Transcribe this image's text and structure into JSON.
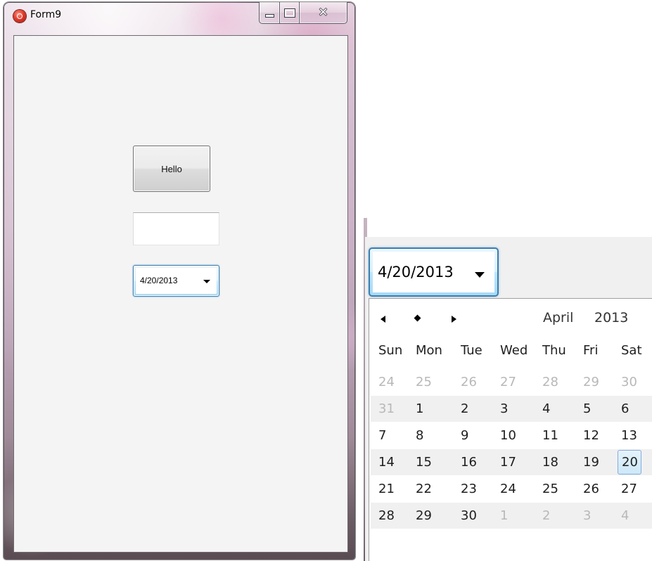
{
  "window": {
    "title": "Form9",
    "minimize_icon": "minimize-icon",
    "maximize_icon": "maximize-icon",
    "close_icon": "close-icon"
  },
  "form": {
    "button_label": "Hello",
    "textbox_value": "",
    "date_value": "4/20/2013"
  },
  "datepicker": {
    "value": "4/20/2013",
    "calendar": {
      "month": "April",
      "year": "2013",
      "weekdays": [
        "Sun",
        "Mon",
        "Tue",
        "Wed",
        "Thu",
        "Fri",
        "Sat"
      ],
      "weeks": [
        [
          {
            "d": "24",
            "dim": true
          },
          {
            "d": "25",
            "dim": true
          },
          {
            "d": "26",
            "dim": true
          },
          {
            "d": "27",
            "dim": true
          },
          {
            "d": "28",
            "dim": true
          },
          {
            "d": "29",
            "dim": true
          },
          {
            "d": "30",
            "dim": true
          }
        ],
        [
          {
            "d": "31",
            "dim": true
          },
          {
            "d": "1"
          },
          {
            "d": "2"
          },
          {
            "d": "3"
          },
          {
            "d": "4"
          },
          {
            "d": "5"
          },
          {
            "d": "6"
          }
        ],
        [
          {
            "d": "7"
          },
          {
            "d": "8"
          },
          {
            "d": "9"
          },
          {
            "d": "10"
          },
          {
            "d": "11"
          },
          {
            "d": "12"
          },
          {
            "d": "13"
          }
        ],
        [
          {
            "d": "14"
          },
          {
            "d": "15"
          },
          {
            "d": "16"
          },
          {
            "d": "17"
          },
          {
            "d": "18"
          },
          {
            "d": "19"
          },
          {
            "d": "20",
            "selected": true
          }
        ],
        [
          {
            "d": "21"
          },
          {
            "d": "22"
          },
          {
            "d": "23"
          },
          {
            "d": "24"
          },
          {
            "d": "25"
          },
          {
            "d": "26"
          },
          {
            "d": "27"
          }
        ],
        [
          {
            "d": "28"
          },
          {
            "d": "29"
          },
          {
            "d": "30"
          },
          {
            "d": "1",
            "dim": true
          },
          {
            "d": "2",
            "dim": true
          },
          {
            "d": "3",
            "dim": true
          },
          {
            "d": "4",
            "dim": true
          }
        ]
      ]
    }
  },
  "colors": {
    "accent_border": "#3c7fb1",
    "selected_day_border": "#84acdd",
    "dim_day": "#b8b8b8",
    "shaded_row": "#f0f0f0"
  }
}
